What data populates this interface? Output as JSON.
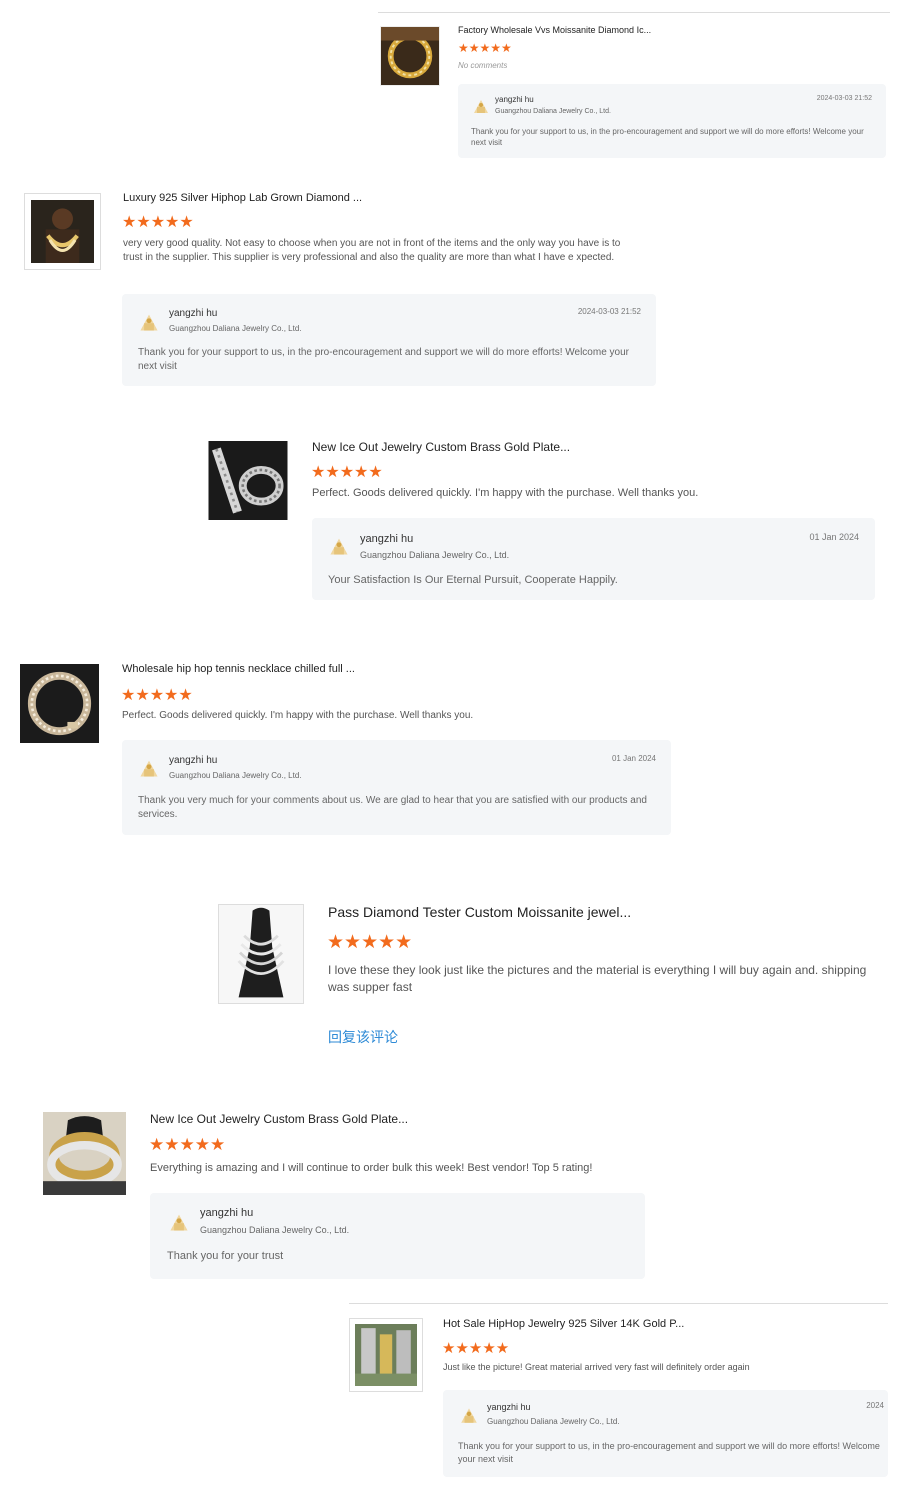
{
  "reviews": [
    {
      "title": "Factory Wholesale Vvs Moissanite Diamond Ic...",
      "stars": "★★★★★",
      "no_comments": "No comments",
      "reply": {
        "name": "yangzhi hu",
        "company": "Guangzhou Daliana Jewelry Co., Ltd.",
        "date": "2024-03-03 21:52",
        "text": "Thank you for your support to us, in the pro-encouragement and support we will do more efforts! Welcome your next visit"
      }
    },
    {
      "title": "Luxury 925 Silver Hiphop Lab Grown Diamond ...",
      "stars": "★★★★★",
      "comment": "very very good quality. Not easy to choose when you are not in front of the items and the only way you have is to trust in the supplier. This supplier is very professional and also the quality are more than what I have e xpected.",
      "reply": {
        "name": "yangzhi hu",
        "company": "Guangzhou Daliana Jewelry Co., Ltd.",
        "date": "2024-03-03 21:52",
        "text": "Thank you for your support to us, in the pro-encouragement and support we will do more efforts! Welcome your next visit"
      }
    },
    {
      "title": "New Ice Out Jewelry Custom Brass Gold Plate...",
      "stars": "★★★★★",
      "comment": "Perfect. Goods delivered quickly. I'm happy with the purchase. Well thanks you.",
      "reply": {
        "name": "yangzhi hu",
        "company": "Guangzhou Daliana Jewelry Co., Ltd.",
        "date": "01 Jan 2024",
        "text": "Your Satisfaction Is Our Eternal Pursuit, Cooperate Happily."
      }
    },
    {
      "title": "Wholesale hip hop tennis necklace chilled full ...",
      "stars": "★★★★★",
      "comment": "Perfect. Goods delivered quickly. I'm happy with the purchase. Well thanks you.",
      "reply": {
        "name": "yangzhi hu",
        "company": "Guangzhou Daliana Jewelry Co., Ltd.",
        "date": "01 Jan 2024",
        "text": "Thank you very much for your comments about us. We are glad to hear that you are satisfied with our products and services."
      }
    },
    {
      "title": "Pass Diamond Tester Custom Moissanite jewel...",
      "stars": "★★★★★",
      "comment": "I love these they look just like the pictures and the material is everything I will buy again and. shipping was supper fast",
      "reply_link": "回复该评论"
    },
    {
      "title": "New Ice Out Jewelry Custom Brass Gold Plate...",
      "stars": "★★★★★",
      "comment": "Everything is amazing and I will continue to order bulk this week!  Best vendor! Top 5 rating!",
      "reply": {
        "name": "yangzhi hu",
        "company": "Guangzhou Daliana Jewelry Co., Ltd.",
        "text": "Thank you for your trust"
      }
    },
    {
      "title": "Hot Sale HipHop Jewelry 925 Silver 14K Gold P...",
      "stars": "★★★★★",
      "comment": "Just like the picture! Great material arrived very fast will definitely order again",
      "reply": {
        "name": "yangzhi hu",
        "company": "Guangzhou Daliana Jewelry Co., Ltd.",
        "date": "2024",
        "text": "Thank you for your support to us, in the pro-encouragement and support we will do more efforts! Welcome your next visit"
      }
    }
  ],
  "colors": {
    "star": "#f26b1d",
    "reply_bg": "#f4f6f8",
    "link": "#2d8ad6"
  },
  "icons": {
    "product_image": "product-thumbnail",
    "supplier_logo": "supplier-logo-icon",
    "star": "star-icon"
  }
}
